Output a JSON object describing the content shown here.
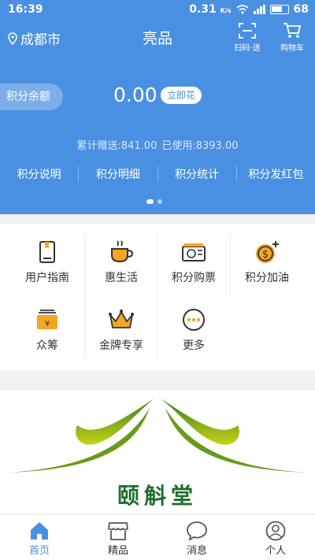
{
  "status_bar": {
    "time": "16:39",
    "net_speed": "0.31",
    "net_unit": "K/s",
    "battery": "68"
  },
  "header": {
    "city": "成都市",
    "title": "亮品",
    "scan_label": "扫码·送",
    "cart_label": "购物车"
  },
  "balance": {
    "label": "积分余额",
    "value": "0.00",
    "spend_button": "立即花",
    "gifted": "累计赠送:841.00",
    "used": "已使用:8393.00"
  },
  "quick_links": [
    "积分说明",
    "积分明细",
    "积分统计",
    "积分发红包"
  ],
  "services": [
    {
      "label": "用户指南",
      "icon": "guide-book-icon"
    },
    {
      "label": "惠生活",
      "icon": "coffee-cup-icon"
    },
    {
      "label": "积分购票",
      "icon": "ticket-icon"
    },
    {
      "label": "积分加油",
      "icon": "coin-plus-icon"
    },
    {
      "label": "众筹",
      "icon": "wallet-icon"
    },
    {
      "label": "金牌专享",
      "icon": "crown-icon"
    },
    {
      "label": "更多",
      "icon": "more-dots-icon"
    }
  ],
  "banner": {
    "brand_text": "颐斛堂"
  },
  "tabs": [
    {
      "label": "首页",
      "icon": "home-icon",
      "active": true
    },
    {
      "label": "精品",
      "icon": "store-icon",
      "active": false
    },
    {
      "label": "消息",
      "icon": "chat-icon",
      "active": false
    },
    {
      "label": "个人",
      "icon": "user-icon",
      "active": false
    }
  ],
  "colors": {
    "primary": "#4a90e2",
    "accent": "#f5a623",
    "brand_green": "#1e6e2e"
  }
}
